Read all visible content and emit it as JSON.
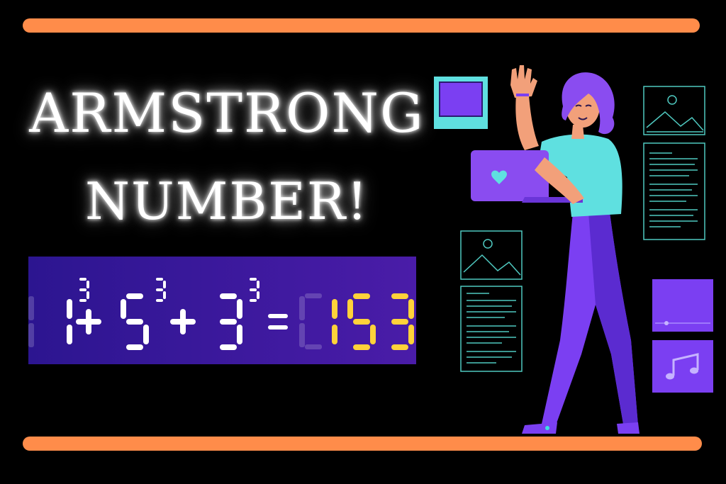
{
  "banner": {
    "title_line1": "ARMSTRONG",
    "title_line2": "NUMBER!",
    "equation": {
      "bases": [
        "1",
        "5",
        "3"
      ],
      "exponent": "3",
      "result": "153"
    }
  },
  "colors": {
    "accent_bar": "#ff8c4a",
    "background": "#000000",
    "panel": "#3a1a99",
    "digit": "#ffffff",
    "result_digit": "#ffd23a",
    "teal": "#5fe0e0",
    "purple": "#7b3ff2",
    "line_art": "#4fc9c0"
  },
  "icons": [
    "image-placeholder-icon",
    "text-lines-icon",
    "music-note-icon",
    "laptop-heart-icon"
  ]
}
